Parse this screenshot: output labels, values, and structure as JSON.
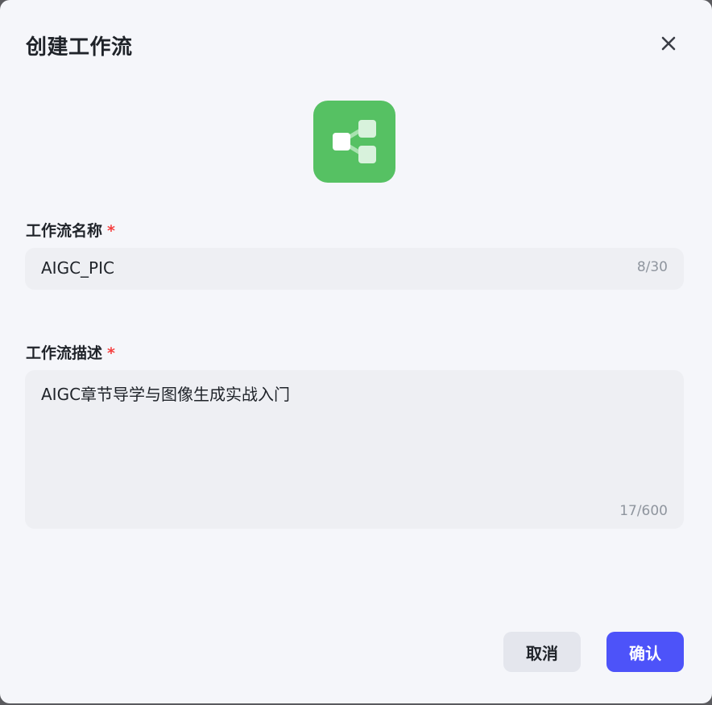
{
  "dialog": {
    "title": "创建工作流",
    "close_icon": "close-icon",
    "app_icon": "workflow-icon",
    "app_icon_color": "#56c163"
  },
  "name_field": {
    "label": "工作流名称",
    "required_mark": "*",
    "value": "AIGC_PIC",
    "counter": "8/30"
  },
  "description_field": {
    "label": "工作流描述",
    "required_mark": "*",
    "value": "AIGC章节导学与图像生成实战入门",
    "counter": "17/600"
  },
  "footer": {
    "cancel_label": "取消",
    "confirm_label": "确认",
    "confirm_color": "#4d53f9"
  }
}
